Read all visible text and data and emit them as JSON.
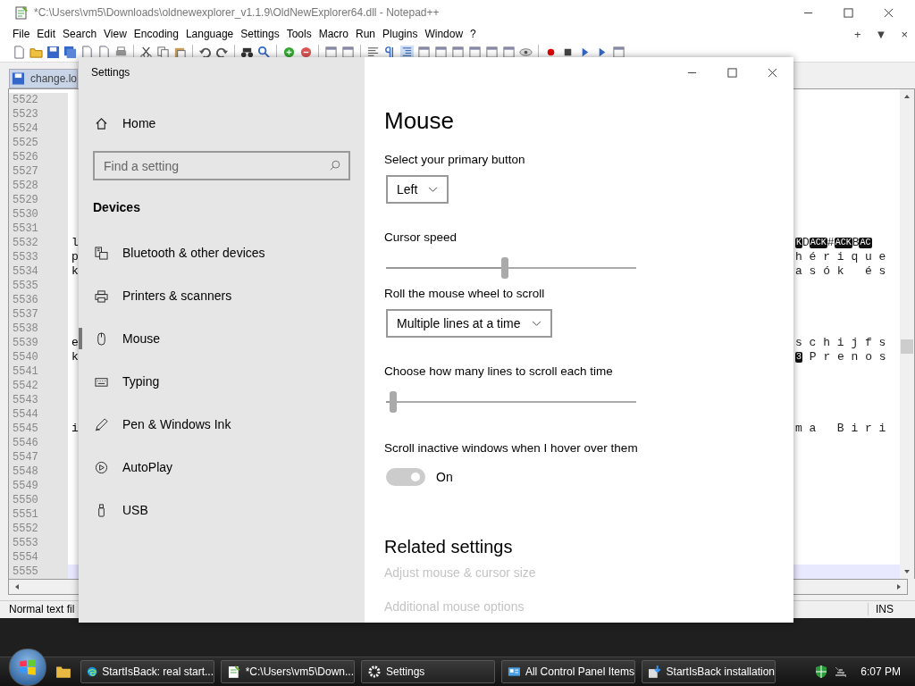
{
  "notepad": {
    "title": "*C:\\Users\\vm5\\Downloads\\oldnewexplorer_v1.1.9\\OldNewExplorer64.dll - Notepad++",
    "menu": [
      "File",
      "Edit",
      "Search",
      "View",
      "Encoding",
      "Language",
      "Settings",
      "Tools",
      "Macro",
      "Run",
      "Plugins",
      "Window",
      "?"
    ],
    "menu_right": [
      "+",
      "▼",
      "×"
    ],
    "tab": {
      "label": "change.lo"
    },
    "lines": [
      {
        "number": "5522",
        "current": false
      },
      {
        "number": "5523",
        "current": false
      },
      {
        "number": "5524",
        "current": false
      },
      {
        "number": "5525",
        "current": false
      },
      {
        "number": "5526",
        "current": false
      },
      {
        "number": "5527",
        "current": false
      },
      {
        "number": "5528",
        "current": false
      },
      {
        "number": "5529",
        "current": false
      },
      {
        "number": "5530",
        "current": false
      },
      {
        "number": "5531",
        "current": false
      },
      {
        "number": "5532",
        "current": false,
        "left": "l",
        "right": [
          {
            "text": "K",
            "inverse": true
          },
          {
            "text": "D",
            "inverse": false
          },
          {
            "text": "ACK",
            "inverse": true
          },
          {
            "text": "#",
            "inverse": false
          },
          {
            "text": "ACK",
            "inverse": true
          },
          {
            "text": "B",
            "inverse": false
          },
          {
            "text": "AC",
            "inverse": true
          }
        ]
      },
      {
        "number": "5533",
        "current": false,
        "left": "p",
        "right": [
          {
            "text": "h é r i q u e",
            "inverse": false
          }
        ]
      },
      {
        "number": "5534",
        "current": false,
        "left": "k",
        "right": [
          {
            "text": "a s ó k   é s",
            "inverse": false
          }
        ]
      },
      {
        "number": "5535",
        "current": false
      },
      {
        "number": "5536",
        "current": false
      },
      {
        "number": "5537",
        "current": false
      },
      {
        "number": "5538",
        "current": false
      },
      {
        "number": "5539",
        "current": false,
        "left": "e",
        "right": [
          {
            "text": "s c h i j f s",
            "inverse": false
          }
        ]
      },
      {
        "number": "5540",
        "current": false,
        "left": "k",
        "right": [
          {
            "text": "3",
            "inverse": true
          },
          {
            "text": " P r e n o s",
            "inverse": false
          }
        ]
      },
      {
        "number": "5541",
        "current": false
      },
      {
        "number": "5542",
        "current": false
      },
      {
        "number": "5543",
        "current": false
      },
      {
        "number": "5544",
        "current": false
      },
      {
        "number": "5545",
        "current": false,
        "left": "i",
        "right": [
          {
            "text": "m a   B i r i",
            "inverse": false
          }
        ]
      },
      {
        "number": "5546",
        "current": false
      },
      {
        "number": "5547",
        "current": false
      },
      {
        "number": "5548",
        "current": false
      },
      {
        "number": "5549",
        "current": false
      },
      {
        "number": "5550",
        "current": false
      },
      {
        "number": "5551",
        "current": false
      },
      {
        "number": "5552",
        "current": false
      },
      {
        "number": "5553",
        "current": false
      },
      {
        "number": "5554",
        "current": false
      },
      {
        "number": "5555",
        "current": true
      }
    ],
    "status_bar": {
      "left": "Normal text fil",
      "right": "INS"
    }
  },
  "settings": {
    "title": "Settings",
    "home": "Home",
    "search": {
      "placeholder": "Find a setting"
    },
    "section": "Devices",
    "nav": [
      {
        "label": "Bluetooth & other devices",
        "kind": "device",
        "selected": false
      },
      {
        "label": "Printers & scanners",
        "kind": "printer",
        "selected": false
      },
      {
        "label": "Mouse",
        "kind": "mouse",
        "selected": true
      },
      {
        "label": "Typing",
        "kind": "keyboard",
        "selected": false
      },
      {
        "label": "Pen & Windows Ink",
        "kind": "pen",
        "selected": false
      },
      {
        "label": "AutoPlay",
        "kind": "autoplay",
        "selected": false
      },
      {
        "label": "USB",
        "kind": "usb",
        "selected": false
      }
    ],
    "heading": "Mouse",
    "controls": [
      {
        "kind": "dropdown",
        "label": "Select your primary button",
        "value": "Left"
      },
      {
        "kind": "slider",
        "label": "Cursor speed",
        "level": 0.475
      },
      {
        "kind": "dropdown",
        "label": "Roll the mouse wheel to scroll",
        "value": "Multiple lines at a time"
      },
      {
        "kind": "slider",
        "label": "Choose how many lines to scroll each time",
        "level": 0.03
      },
      {
        "kind": "toggle",
        "label": "Scroll inactive windows when I hover over them",
        "on": true,
        "disabled": true,
        "state_text": "On"
      }
    ],
    "related": {
      "heading": "Related settings",
      "links": [
        "Adjust mouse & cursor size",
        "Additional mouse options"
      ]
    }
  },
  "taskbar": {
    "items": [
      {
        "label": "StartIsBack: real start...",
        "kind": "browser"
      },
      {
        "label": "*C:\\Users\\vm5\\Down...",
        "kind": "notepad"
      },
      {
        "label": "Settings",
        "kind": "settings"
      },
      {
        "label": "All Control Panel Items",
        "kind": "control-panel"
      },
      {
        "label": "StartIsBack installation",
        "kind": "installer"
      }
    ],
    "clock": "6:07 PM"
  }
}
